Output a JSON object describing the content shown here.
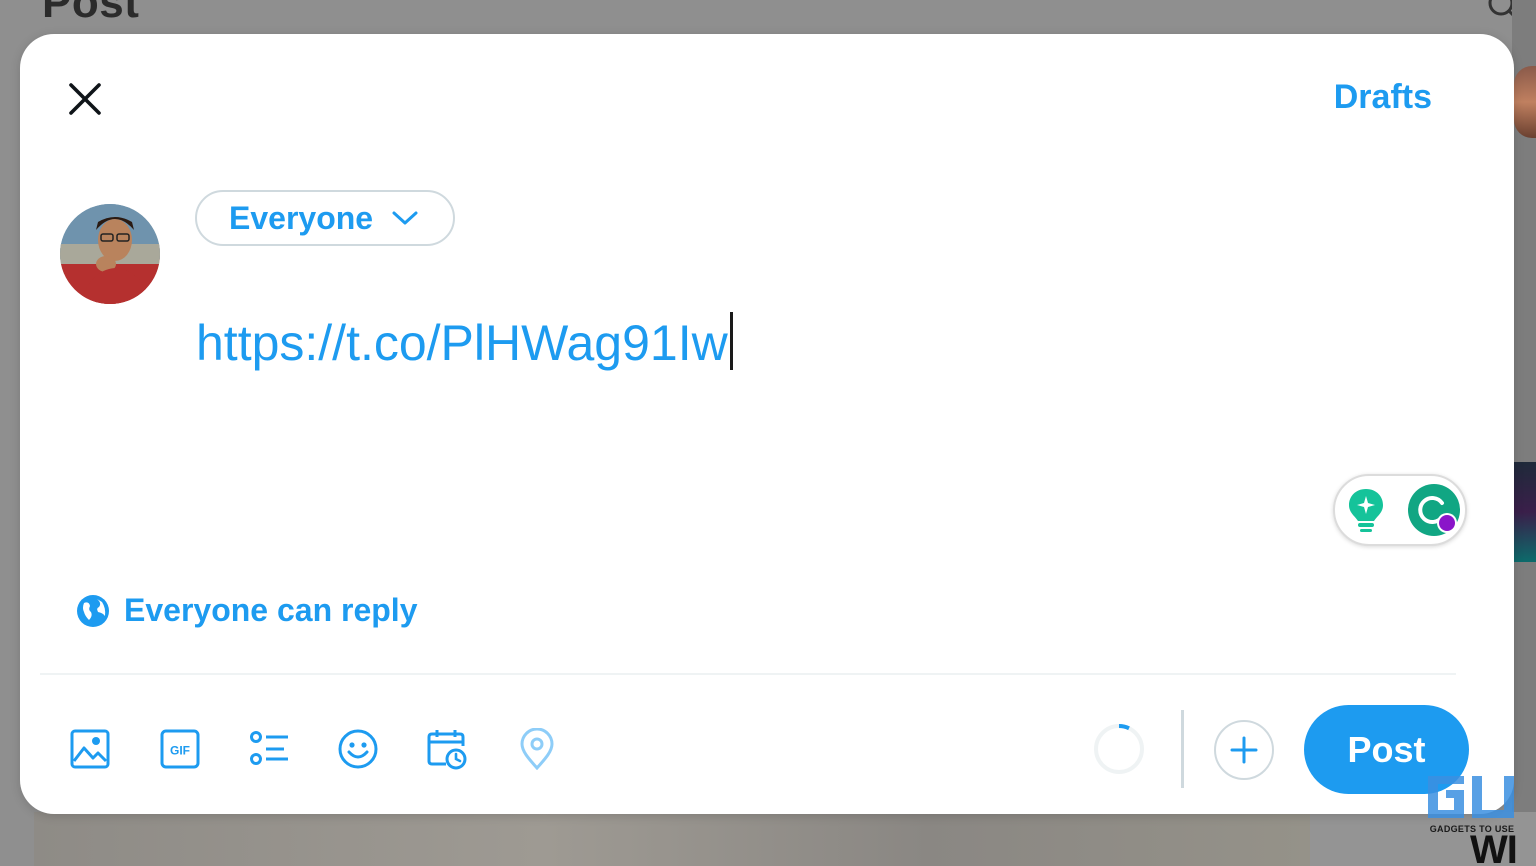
{
  "background": {
    "page_title": "Post",
    "bottom_text": "WI"
  },
  "modal": {
    "drafts_label": "Drafts",
    "audience_label": "Everyone",
    "compose_text": "https://t.co/PlHWag91Iw",
    "reply_setting_label": "Everyone can reply",
    "post_label": "Post"
  },
  "toolbar": {
    "icons": [
      "image-icon",
      "gif-icon",
      "poll-icon",
      "emoji-icon",
      "schedule-icon",
      "location-icon"
    ]
  },
  "watermark": {
    "text": "GADGETS TO USE"
  },
  "colors": {
    "accent": "#1d9bf0",
    "location_disabled": "#8ecdf8",
    "border": "#cfd9de"
  }
}
